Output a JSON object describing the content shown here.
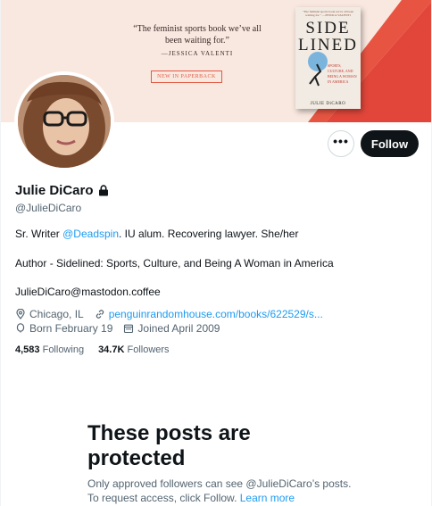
{
  "banner": {
    "quote": "“The feminist sports book we’ve all been waiting for.”",
    "quote_author": "—JESSICA VALENTI",
    "paperback_label": "NEW IN PAPERBACK",
    "book_top_text": "\"The feminist sports book we've all been waiting for.\" —JESSICA VALENTI",
    "book_title": "SIDE LINED",
    "book_subtitle": "SPORTS, CULTURE, AND BEING A WOMAN IN AMERICA",
    "book_author": "JULIE DiCARO"
  },
  "profile": {
    "name": "Julie DiCaro",
    "handle": "@JulieDiCaro",
    "bio_prefix": "Sr. Writer ",
    "bio_mention": "@Deadspin",
    "bio_suffix": ". IU alum.  Recovering lawyer. She/her",
    "bio_line2": "Author - Sidelined: Sports, Culture, and Being A Woman in America",
    "bio_line3": "JulieDiCaro@mastodon.coffee",
    "location": "Chicago, IL",
    "website": "penguinrandomhouse.com/books/622529/s...",
    "born": "Born February 19",
    "joined": "Joined April 2009",
    "following_count": "4,583",
    "following_label": "Following",
    "followers_count": "34.7K",
    "followers_label": "Followers"
  },
  "actions": {
    "more_label": "•••",
    "follow_label": "Follow"
  },
  "protected": {
    "title": "These posts are protected",
    "description": "Only approved followers can see @JulieDiCaro’s posts. To request access, click Follow. ",
    "learn_more": "Learn more"
  },
  "colors": {
    "accent": "#1d9bf0",
    "text_primary": "#0f1419",
    "text_secondary": "#536471",
    "banner_bg": "#f9e8df",
    "banner_red": "#e2463a"
  }
}
